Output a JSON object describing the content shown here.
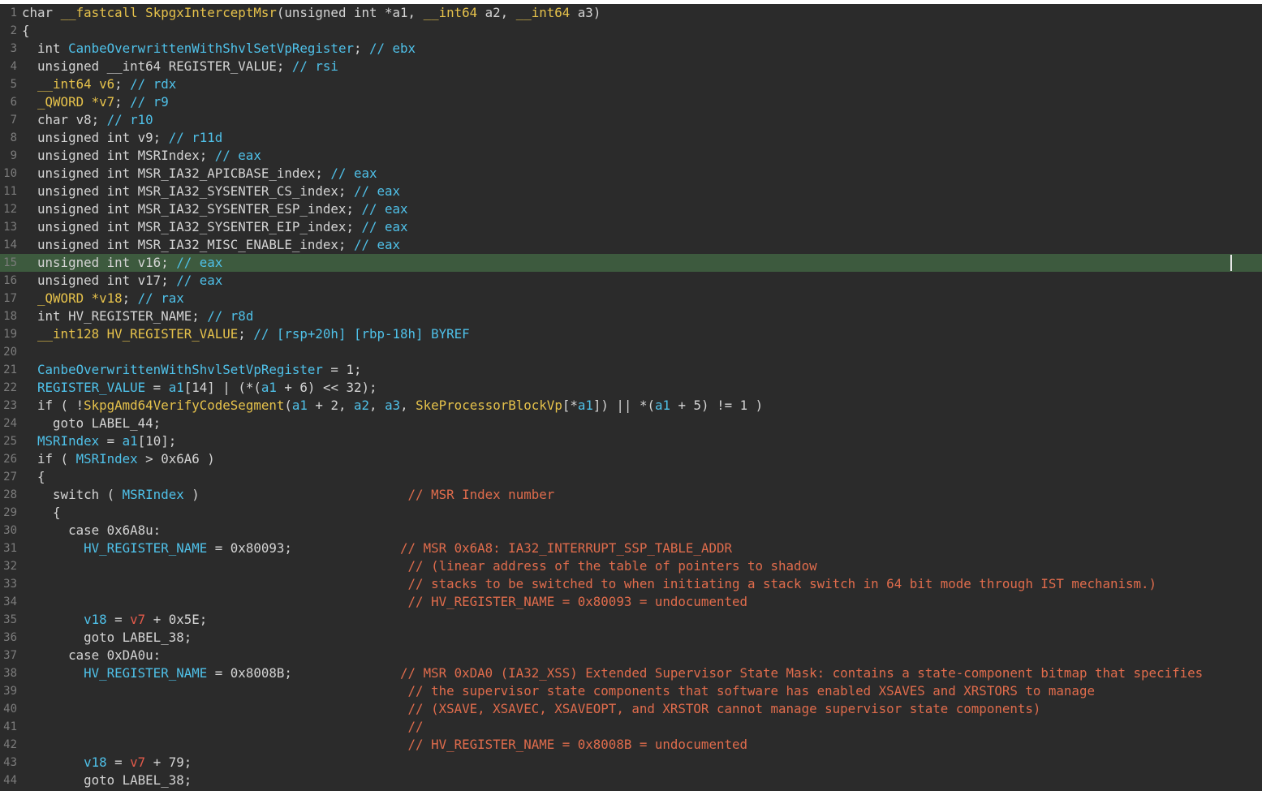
{
  "editor": {
    "current_line": 15,
    "colors": {
      "background": "#2b2b2b",
      "current_line": "#3d5a3e",
      "function_name": "#e6c24b",
      "variable": "#4fc1e9",
      "local_red": "#e35a4a",
      "comment": "#e06c4c",
      "default": "#d4d4d4"
    },
    "lines": [
      {
        "n": "1",
        "t": [
          [
            "t-d",
            "char "
          ],
          [
            "t-y",
            "__fastcall SkpgxInterceptMsr"
          ],
          [
            "t-d",
            "(unsigned int *a1, "
          ],
          [
            "t-y",
            "__int64"
          ],
          [
            "t-d",
            " a2, "
          ],
          [
            "t-y",
            "__int64"
          ],
          [
            "t-d",
            " a3)"
          ]
        ]
      },
      {
        "n": "2",
        "t": [
          [
            "t-d",
            "{"
          ]
        ]
      },
      {
        "n": "3",
        "t": [
          [
            "t-d",
            "  int "
          ],
          [
            "t-c",
            "CanbeOverwrittenWithShvlSetVpRegister"
          ],
          [
            "t-d",
            "; "
          ],
          [
            "t-c",
            "// ebx"
          ]
        ]
      },
      {
        "n": "4",
        "t": [
          [
            "t-d",
            "  unsigned __int64 REGISTER_VALUE; "
          ],
          [
            "t-c",
            "// rsi"
          ]
        ]
      },
      {
        "n": "5",
        "t": [
          [
            "t-y",
            "  __int64 v6"
          ],
          [
            "t-d",
            "; "
          ],
          [
            "t-c",
            "// rdx"
          ]
        ]
      },
      {
        "n": "6",
        "t": [
          [
            "t-y",
            "  _QWORD *v7"
          ],
          [
            "t-d",
            "; "
          ],
          [
            "t-c",
            "// r9"
          ]
        ]
      },
      {
        "n": "7",
        "t": [
          [
            "t-d",
            "  char v8; "
          ],
          [
            "t-c",
            "// r10"
          ]
        ]
      },
      {
        "n": "8",
        "t": [
          [
            "t-d",
            "  unsigned int v9; "
          ],
          [
            "t-c",
            "// r11d"
          ]
        ]
      },
      {
        "n": "9",
        "t": [
          [
            "t-d",
            "  unsigned int MSRIndex; "
          ],
          [
            "t-c",
            "// eax"
          ]
        ]
      },
      {
        "n": "10",
        "t": [
          [
            "t-d",
            "  unsigned int MSR_IA32_APICBASE_index; "
          ],
          [
            "t-c",
            "// eax"
          ]
        ]
      },
      {
        "n": "11",
        "t": [
          [
            "t-d",
            "  unsigned int MSR_IA32_SYSENTER_CS_index; "
          ],
          [
            "t-c",
            "// eax"
          ]
        ]
      },
      {
        "n": "12",
        "t": [
          [
            "t-d",
            "  unsigned int MSR_IA32_SYSENTER_ESP_index; "
          ],
          [
            "t-c",
            "// eax"
          ]
        ]
      },
      {
        "n": "13",
        "t": [
          [
            "t-d",
            "  unsigned int MSR_IA32_SYSENTER_EIP_index; "
          ],
          [
            "t-c",
            "// eax"
          ]
        ]
      },
      {
        "n": "14",
        "t": [
          [
            "t-d",
            "  unsigned int MSR_IA32_MISC_ENABLE_index; "
          ],
          [
            "t-c",
            "// eax"
          ]
        ]
      },
      {
        "n": "15",
        "t": [
          [
            "t-d",
            "  unsigned int v16; "
          ],
          [
            "t-c",
            "// eax"
          ]
        ]
      },
      {
        "n": "16",
        "t": [
          [
            "t-d",
            "  unsigned int v17; "
          ],
          [
            "t-c",
            "// eax"
          ]
        ]
      },
      {
        "n": "17",
        "t": [
          [
            "t-y",
            "  _QWORD *v18"
          ],
          [
            "t-d",
            "; "
          ],
          [
            "t-c",
            "// rax"
          ]
        ]
      },
      {
        "n": "18",
        "t": [
          [
            "t-d",
            "  int HV_REGISTER_NAME; "
          ],
          [
            "t-c",
            "// r8d"
          ]
        ]
      },
      {
        "n": "19",
        "t": [
          [
            "t-y",
            "  __int128 HV_REGISTER_VALUE"
          ],
          [
            "t-d",
            "; "
          ],
          [
            "t-c",
            "// [rsp+20h] [rbp-18h] BYREF"
          ]
        ]
      },
      {
        "n": "20",
        "t": []
      },
      {
        "n": "21",
        "t": [
          [
            "t-c",
            "  CanbeOverwrittenWithShvlSetVpRegister"
          ],
          [
            "t-d",
            " = 1;"
          ]
        ]
      },
      {
        "n": "22",
        "t": [
          [
            "t-c",
            "  REGISTER_VALUE"
          ],
          [
            "t-d",
            " = "
          ],
          [
            "t-c",
            "a1"
          ],
          [
            "t-d",
            "[14] | (*("
          ],
          [
            "t-c",
            "a1"
          ],
          [
            "t-d",
            " + 6) << 32);"
          ]
        ]
      },
      {
        "n": "23",
        "t": [
          [
            "t-d",
            "  if ( !"
          ],
          [
            "t-y",
            "SkpgAmd64VerifyCodeSegment"
          ],
          [
            "t-d",
            "("
          ],
          [
            "t-c",
            "a1"
          ],
          [
            "t-d",
            " + 2, "
          ],
          [
            "t-c",
            "a2"
          ],
          [
            "t-d",
            ", "
          ],
          [
            "t-c",
            "a3"
          ],
          [
            "t-d",
            ", "
          ],
          [
            "t-y",
            "SkeProcessorBlockVp"
          ],
          [
            "t-d",
            "[*"
          ],
          [
            "t-c",
            "a1"
          ],
          [
            "t-d",
            "]) || *("
          ],
          [
            "t-c",
            "a1"
          ],
          [
            "t-d",
            " + 5) != 1 )"
          ]
        ]
      },
      {
        "n": "24",
        "t": [
          [
            "t-d",
            "    goto LABEL_44;"
          ]
        ]
      },
      {
        "n": "25",
        "t": [
          [
            "t-c",
            "  MSRIndex"
          ],
          [
            "t-d",
            " = "
          ],
          [
            "t-c",
            "a1"
          ],
          [
            "t-d",
            "[10];"
          ]
        ]
      },
      {
        "n": "26",
        "t": [
          [
            "t-d",
            "  if ( "
          ],
          [
            "t-c",
            "MSRIndex"
          ],
          [
            "t-d",
            " > 0x6A6 )"
          ]
        ]
      },
      {
        "n": "27",
        "t": [
          [
            "t-d",
            "  {"
          ]
        ]
      },
      {
        "n": "28",
        "t": [
          [
            "t-d",
            "    switch ( "
          ],
          [
            "t-c",
            "MSRIndex"
          ],
          [
            "t-d",
            " )                           "
          ],
          [
            "t-o",
            "// MSR Index number"
          ]
        ]
      },
      {
        "n": "29",
        "t": [
          [
            "t-d",
            "    {"
          ]
        ]
      },
      {
        "n": "30",
        "t": [
          [
            "t-d",
            "      case 0x6A8u:"
          ]
        ]
      },
      {
        "n": "31",
        "t": [
          [
            "t-c",
            "        HV_REGISTER_NAME"
          ],
          [
            "t-d",
            " = 0x80093;              "
          ],
          [
            "t-o",
            "// MSR 0x6A8: IA32_INTERRUPT_SSP_TABLE_ADDR"
          ]
        ]
      },
      {
        "n": "32",
        "t": [
          [
            "t-d",
            "                                                  "
          ],
          [
            "t-o",
            "// (linear address of the table of pointers to shadow"
          ]
        ]
      },
      {
        "n": "33",
        "t": [
          [
            "t-d",
            "                                                  "
          ],
          [
            "t-o",
            "// stacks to be switched to when initiating a stack switch in 64 bit mode through IST mechanism.)"
          ]
        ]
      },
      {
        "n": "34",
        "t": [
          [
            "t-d",
            "                                                  "
          ],
          [
            "t-o",
            "// HV_REGISTER_NAME = 0x80093 = undocumented"
          ]
        ]
      },
      {
        "n": "35",
        "t": [
          [
            "t-c",
            "        v18"
          ],
          [
            "t-d",
            " = "
          ],
          [
            "t-r",
            "v7"
          ],
          [
            "t-d",
            " + 0x5E;"
          ]
        ]
      },
      {
        "n": "36",
        "t": [
          [
            "t-d",
            "        goto LABEL_38;"
          ]
        ]
      },
      {
        "n": "37",
        "t": [
          [
            "t-d",
            "      case 0xDA0u:"
          ]
        ]
      },
      {
        "n": "38",
        "t": [
          [
            "t-c",
            "        HV_REGISTER_NAME"
          ],
          [
            "t-d",
            " = 0x8008B;              "
          ],
          [
            "t-o",
            "// MSR 0xDA0 (IA32_XSS) Extended Supervisor State Mask: contains a state-component bitmap that specifies"
          ]
        ]
      },
      {
        "n": "39",
        "t": [
          [
            "t-d",
            "                                                  "
          ],
          [
            "t-o",
            "// the supervisor state components that software has enabled XSAVES and XRSTORS to manage"
          ]
        ]
      },
      {
        "n": "40",
        "t": [
          [
            "t-d",
            "                                                  "
          ],
          [
            "t-o",
            "// (XSAVE, XSAVEC, XSAVEOPT, and XRSTOR cannot manage supervisor state components)"
          ]
        ]
      },
      {
        "n": "41",
        "t": [
          [
            "t-d",
            "                                                  "
          ],
          [
            "t-o",
            "//"
          ]
        ]
      },
      {
        "n": "42",
        "t": [
          [
            "t-d",
            "                                                  "
          ],
          [
            "t-o",
            "// HV_REGISTER_NAME = 0x8008B = undocumented"
          ]
        ]
      },
      {
        "n": "43",
        "t": [
          [
            "t-c",
            "        v18"
          ],
          [
            "t-d",
            " = "
          ],
          [
            "t-r",
            "v7"
          ],
          [
            "t-d",
            " + 79;"
          ]
        ]
      },
      {
        "n": "44",
        "t": [
          [
            "t-d",
            "        goto LABEL_38;"
          ]
        ]
      }
    ]
  }
}
